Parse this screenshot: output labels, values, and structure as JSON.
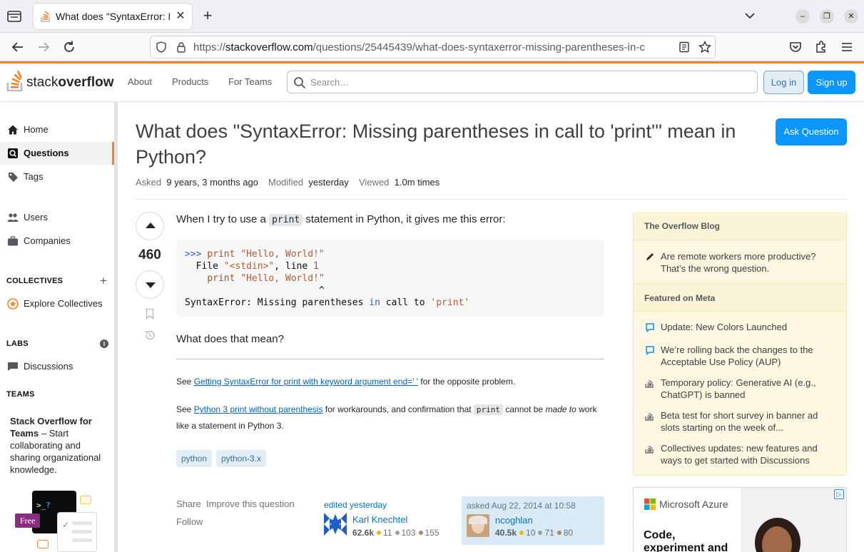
{
  "browser": {
    "tab_title": "What does \"SyntaxError: Missing parentheses in call to 'print'\" mean in Python?",
    "url_prefix": "https://",
    "url_host": "stackoverflow.com",
    "url_path": "/questions/25445439/what-does-syntaxerror-missing-parentheses-in-c"
  },
  "header": {
    "logo_light": "stack",
    "logo_bold": "overflow",
    "nav": [
      "About",
      "Products",
      "For Teams"
    ],
    "search_placeholder": "Search…",
    "login": "Log in",
    "signup": "Sign up"
  },
  "sidebar": {
    "items": [
      {
        "label": "Home",
        "icon": "home-icon"
      },
      {
        "label": "Questions",
        "icon": "questions-icon"
      },
      {
        "label": "Tags",
        "icon": "tag-icon"
      },
      {
        "label": "Users",
        "icon": "users-icon"
      },
      {
        "label": "Companies",
        "icon": "briefcase-icon"
      }
    ],
    "collectives_heading": "COLLECTIVES",
    "explore_collectives": "Explore Collectives",
    "labs_heading": "LABS",
    "discussions": "Discussions",
    "teams_heading": "TEAMS",
    "teams_promo_bold": "Stack Overflow for Teams",
    "teams_promo_text": " – Start collaborating and sharing organizational knowledge.",
    "free_badge": "Free"
  },
  "question": {
    "title": "What does \"SyntaxError: Missing parentheses in call to 'print'\" mean in Python?",
    "ask_button": "Ask Question",
    "asked_label": "Asked",
    "asked_value": "9 years, 3 months ago",
    "modified_label": "Modified",
    "modified_value": "yesterday",
    "viewed_label": "Viewed",
    "viewed_value": "1.0m times",
    "votes": "460",
    "body_intro_1": "When I try to use a ",
    "body_intro_code": "print",
    "body_intro_2": " statement in Python, it gives me this error:",
    "body_question": "What does that mean?",
    "see1_prefix": "See ",
    "see1_link": "Getting SyntaxError for print with keyword argument end=' '",
    "see1_suffix": " for the opposite problem.",
    "see2_prefix": "See ",
    "see2_link": "Python 3 print without parenthesis",
    "see2_mid": " for workarounds, and confirmation that ",
    "see2_code": "print",
    "see2_mid2": " cannot be ",
    "see2_em": "made to",
    "see2_suffix": " work like a statement in Python 3.",
    "tags": [
      "python",
      "python-3.x"
    ],
    "share": "Share",
    "improve": "Improve this question",
    "follow": "Follow",
    "edited": "edited yesterday",
    "editor_name": "Karl Knechtel",
    "editor_rep": "62.6k",
    "editor_gold": "11",
    "editor_silver": "103",
    "editor_bronze": "155",
    "asked_at": "asked Aug 22, 2014 at 10:58",
    "asker_name": "ncoghlan",
    "asker_rep": "40.5k",
    "asker_gold": "10",
    "asker_silver": "71",
    "asker_bronze": "80"
  },
  "code": {
    "prompt": ">>> ",
    "line1_kw": "print",
    "line1_str": " \"Hello, World!\"",
    "line2_a": "  File ",
    "line2_str": "\"<stdin>\"",
    "line2_b": ", line ",
    "line2_num": "1",
    "line3_kw": "print",
    "line3_str": " \"Hello, World!\"",
    "line4": "                        ^",
    "line5_a": "SyntaxError: Missing parentheses ",
    "line5_in": "in",
    "line5_b": " call to ",
    "line5_str": "'print'"
  },
  "right_sidebar": {
    "blog_heading": "The Overflow Blog",
    "blog_items": [
      "Are remote workers more productive? That’s the wrong question."
    ],
    "meta_heading": "Featured on Meta",
    "meta_items": [
      "Update: New Colors Launched",
      "We’re rolling back the changes to the Acceptable Use Policy (AUP)",
      "Temporary policy: Generative AI (e.g., ChatGPT) is banned",
      "Beta test for short survey in banner ad slots starting on the week of...",
      "Collectives updates: new features and ways to get started with Discussions"
    ],
    "ad_brand": "Microsoft Azure",
    "ad_headline_1": "Code,",
    "ad_headline_2": "experiment and"
  },
  "colors": {
    "accent": "#f48225",
    "primary_button": "#0a95ff",
    "link": "#0074cc"
  }
}
